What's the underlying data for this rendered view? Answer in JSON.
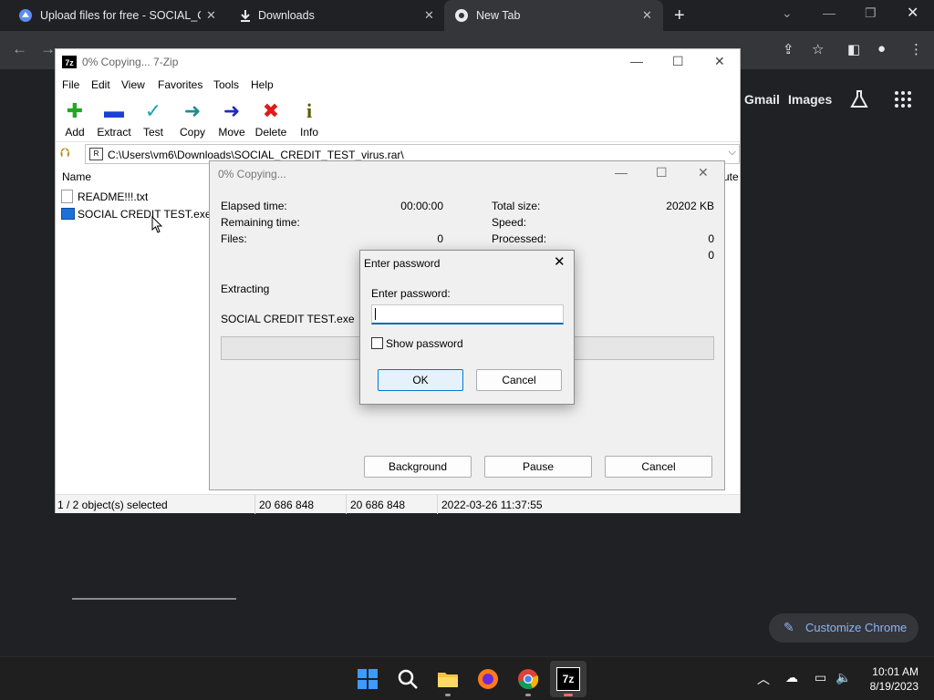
{
  "browser": {
    "tabs": [
      {
        "title": "Upload files for free - SOCIAL_CR",
        "icon": "anonfiles-icon"
      },
      {
        "title": "Downloads",
        "icon": "download-icon"
      },
      {
        "title": "New Tab",
        "icon": "chrome-icon"
      }
    ],
    "new_tab_symbol": "+",
    "close_symbol": "✕",
    "window_controls": {
      "dropdown": "⌄",
      "minimize": "—",
      "restore": "❐",
      "close": "✕"
    },
    "nav": {
      "back": "←",
      "forward": "→"
    },
    "toolbar_icons": {
      "share": "⇪",
      "bookmark": "☆",
      "side_panel": "◧",
      "profile": "●",
      "menu": "⋮"
    },
    "ntp": {
      "gmail": "Gmail",
      "images": "Images",
      "customize": "Customize Chrome",
      "pencil": "✎"
    }
  },
  "zip": {
    "title": "0% Copying... 7-Zip",
    "title_icon": "7z",
    "controls": {
      "minimize": "—",
      "maximize": "☐",
      "close": "✕"
    },
    "menu": [
      "File",
      "Edit",
      "View",
      "Favorites",
      "Tools",
      "Help"
    ],
    "toolbar": [
      {
        "label": "Add",
        "glyph": "✚",
        "color": "#22a822"
      },
      {
        "label": "Extract",
        "glyph": "▬",
        "color": "#1c3fd6"
      },
      {
        "label": "Test",
        "glyph": "✓",
        "color": "#1aa5b5"
      },
      {
        "label": "Copy",
        "glyph": "➜",
        "color": "#1e8e8e"
      },
      {
        "label": "Move",
        "glyph": "➜",
        "color": "#1c2fb5"
      },
      {
        "label": "Delete",
        "glyph": "✖",
        "color": "#e01b1b"
      },
      {
        "label": "Info",
        "glyph": "i",
        "color": "#5c5c00"
      }
    ],
    "path": "C:\\Users\\vm6\\Downloads\\SOCIAL_CREDIT_TEST_virus.rar\\",
    "path_icon": "R",
    "columns": {
      "name": "Name",
      "right": "ute"
    },
    "files": [
      {
        "name": "README!!!.txt"
      },
      {
        "name": "SOCIAL CREDIT TEST.exe"
      }
    ],
    "status": {
      "selection": "1 / 2 object(s) selected",
      "size": "20 686 848",
      "packed": "20 686 848",
      "modified": "2022-03-26 11:37:55"
    }
  },
  "progress": {
    "title": "0% Copying...",
    "controls": {
      "minimize": "—",
      "maximize": "☐",
      "close": "✕"
    },
    "elapsed_label": "Elapsed time:",
    "elapsed_value": "00:00:00",
    "remaining_label": "Remaining time:",
    "files_label": "Files:",
    "files_value": "0",
    "total_size_label": "Total size:",
    "total_size_value": "20202 KB",
    "speed_label": "Speed:",
    "processed_label": "Processed:",
    "processed_value": "0",
    "extra_value": "0",
    "operation": "Extracting",
    "current_file": "SOCIAL CREDIT TEST.exe",
    "progress_fraction": 0,
    "buttons": {
      "background": "Background",
      "pause": "Pause",
      "cancel": "Cancel"
    }
  },
  "password": {
    "title": "Enter password",
    "close": "✕",
    "label": "Enter password:",
    "value": "",
    "show_label": "Show password",
    "ok": "OK",
    "cancel": "Cancel"
  },
  "taskbar": {
    "time": "10:01 AM",
    "date": "8/19/2023",
    "tray": {
      "chevron": "︿",
      "network_off": "☁",
      "display": "▭",
      "volume": "🔈"
    },
    "active_label": "7z"
  }
}
